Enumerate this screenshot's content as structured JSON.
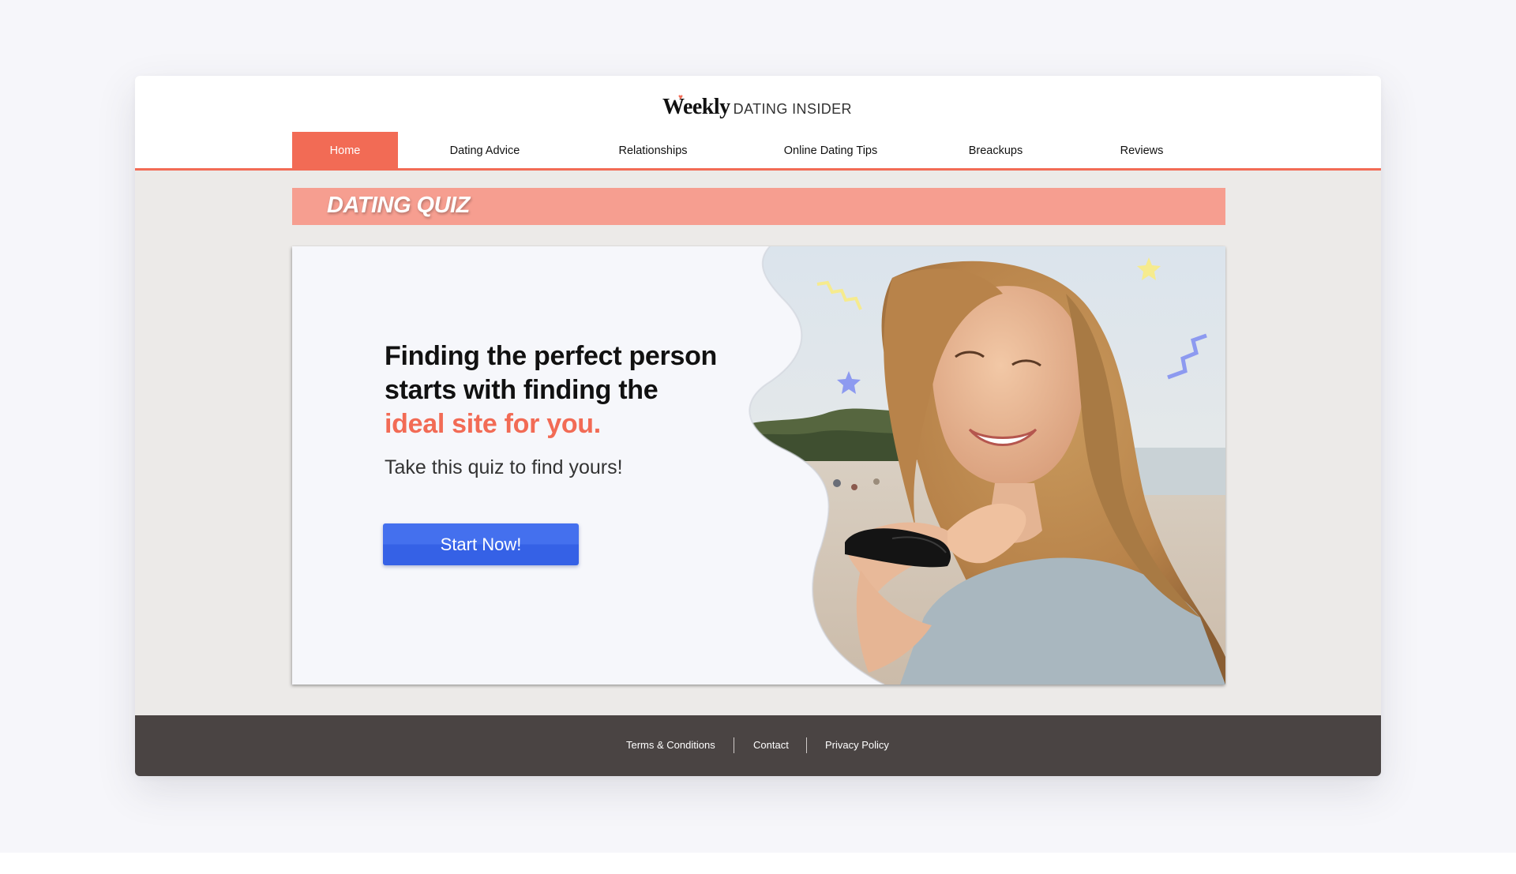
{
  "brand": {
    "name_primary": "Weekly",
    "name_secondary": "DATING INSIDER",
    "accent_color": "#f26b55"
  },
  "nav": {
    "items": [
      {
        "label": "Home",
        "active": true
      },
      {
        "label": "Dating Advice",
        "active": false
      },
      {
        "label": "Relationships",
        "active": false
      },
      {
        "label": "Online Dating Tips",
        "active": false
      },
      {
        "label": "Breackups",
        "active": false
      },
      {
        "label": "Reviews",
        "active": false
      }
    ]
  },
  "banner": {
    "title": "DATING QUIZ",
    "color": "#f69e90"
  },
  "hero": {
    "headline_line1": "Finding the perfect person",
    "headline_line2": "starts with finding the",
    "headline_accent": "ideal site for you.",
    "subtext": "Take this quiz to find yours!",
    "cta_label": "Start Now!",
    "cta_color": "#3d68ea",
    "decorations": [
      "yellow-zigzag",
      "yellow-star",
      "blue-star",
      "blue-zigzag"
    ]
  },
  "footer": {
    "links": [
      "Terms & Conditions",
      "Contact",
      "Privacy Policy"
    ],
    "background": "#4a4443"
  }
}
